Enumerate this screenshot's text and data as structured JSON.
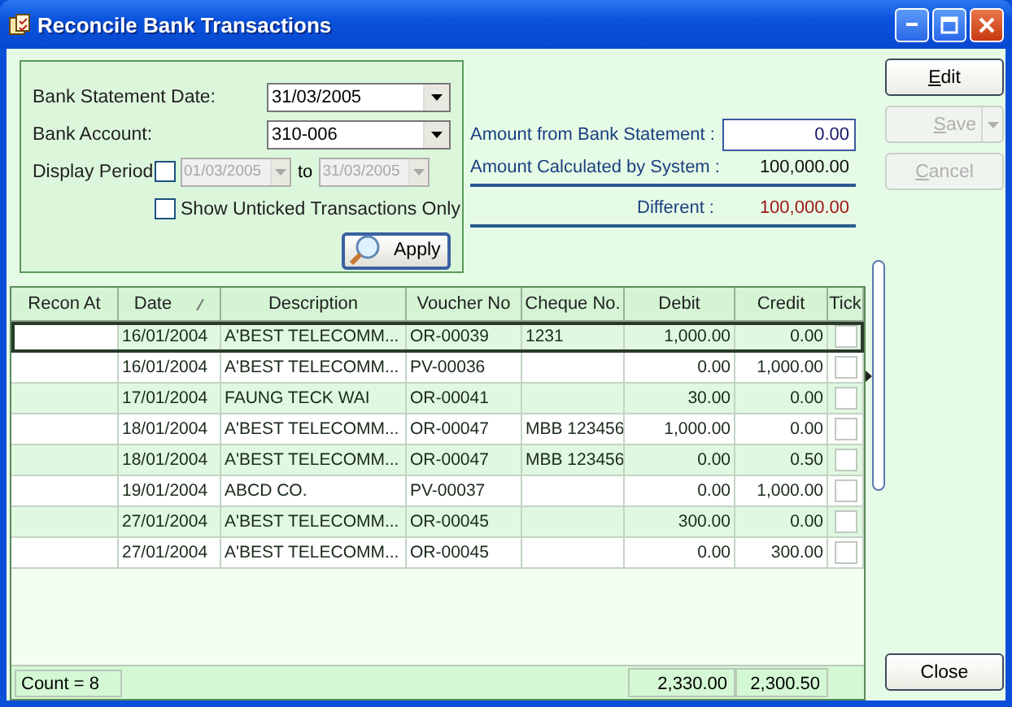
{
  "window": {
    "title": "Reconcile Bank Transactions"
  },
  "filter": {
    "statement_date": {
      "label": "Bank Statement Date:",
      "value": "31/03/2005"
    },
    "bank_account": {
      "label": "Bank Account:",
      "value": "310-006"
    },
    "display_period": {
      "label": "Display Period",
      "checked": false,
      "disabled": true,
      "from": "01/03/2005",
      "separator": "to",
      "to": "31/03/2005"
    },
    "show_unticked": {
      "label": "Show Unticked Transactions Only",
      "checked": false
    },
    "apply": {
      "label": "Apply"
    }
  },
  "summary": [
    {
      "kind": "input",
      "label": "Amount from  Bank Statement :",
      "value": "0.00"
    },
    {
      "kind": "total",
      "label": "Amount Calculated by System :",
      "value": "100,000.00"
    },
    {
      "kind": "difference",
      "label": "Different :",
      "value": "100,000.00"
    }
  ],
  "buttons": [
    {
      "label": "Edit",
      "disabled": false,
      "dropdown": false
    },
    {
      "label": "Save",
      "disabled": true,
      "dropdown": true
    },
    {
      "label": "Cancel",
      "disabled": true,
      "dropdown": false
    }
  ],
  "table": {
    "columns": [
      {
        "label": "Recon At",
        "sorted": false
      },
      {
        "label": "Date",
        "sorted": true
      },
      {
        "label": "Description",
        "sorted": false
      },
      {
        "label": "Voucher No",
        "sorted": false
      },
      {
        "label": "Cheque No.",
        "sorted": false
      },
      {
        "label": "Debit",
        "sorted": false
      },
      {
        "label": "Credit",
        "sorted": false
      },
      {
        "label": "Tick",
        "sorted": false
      }
    ],
    "rows": [
      {
        "selected": true,
        "date": "16/01/2004",
        "description": "A'BEST TELECOMM...",
        "voucher": "OR-00039",
        "cheque": "1231",
        "debit": "1,000.00",
        "credit": "0.00",
        "ticked": false
      },
      {
        "selected": false,
        "date": "16/01/2004",
        "description": "A'BEST TELECOMM...",
        "voucher": "PV-00036",
        "debit": "0.00",
        "credit": "1,000.00",
        "ticked": false
      },
      {
        "selected": false,
        "date": "17/01/2004",
        "description": "FAUNG TECK WAI",
        "voucher": "OR-00041",
        "debit": "30.00",
        "credit": "0.00",
        "ticked": false
      },
      {
        "selected": false,
        "date": "18/01/2004",
        "description": "A'BEST TELECOMM...",
        "voucher": "OR-00047",
        "cheque": "MBB 123456",
        "debit": "1,000.00",
        "credit": "0.00",
        "ticked": false
      },
      {
        "selected": false,
        "date": "18/01/2004",
        "description": "A'BEST TELECOMM...",
        "voucher": "OR-00047",
        "cheque": "MBB 123456",
        "debit": "0.00",
        "credit": "0.50",
        "ticked": false
      },
      {
        "selected": false,
        "date": "19/01/2004",
        "description": "ABCD CO.",
        "voucher": "PV-00037",
        "debit": "0.00",
        "credit": "1,000.00",
        "ticked": false
      },
      {
        "selected": false,
        "date": "27/01/2004",
        "description": "A'BEST TELECOMM...",
        "voucher": "OR-00045",
        "debit": "300.00",
        "credit": "0.00",
        "ticked": false
      },
      {
        "selected": false,
        "date": "27/01/2004",
        "description": "A'BEST TELECOMM...",
        "voucher": "OR-00045",
        "debit": "0.00",
        "credit": "300.00",
        "ticked": false
      }
    ],
    "footer": {
      "count": "Count = 8",
      "debit_total": "2,330.00",
      "credit_total": "2,300.50"
    }
  },
  "close_button": {
    "label": "Close"
  }
}
